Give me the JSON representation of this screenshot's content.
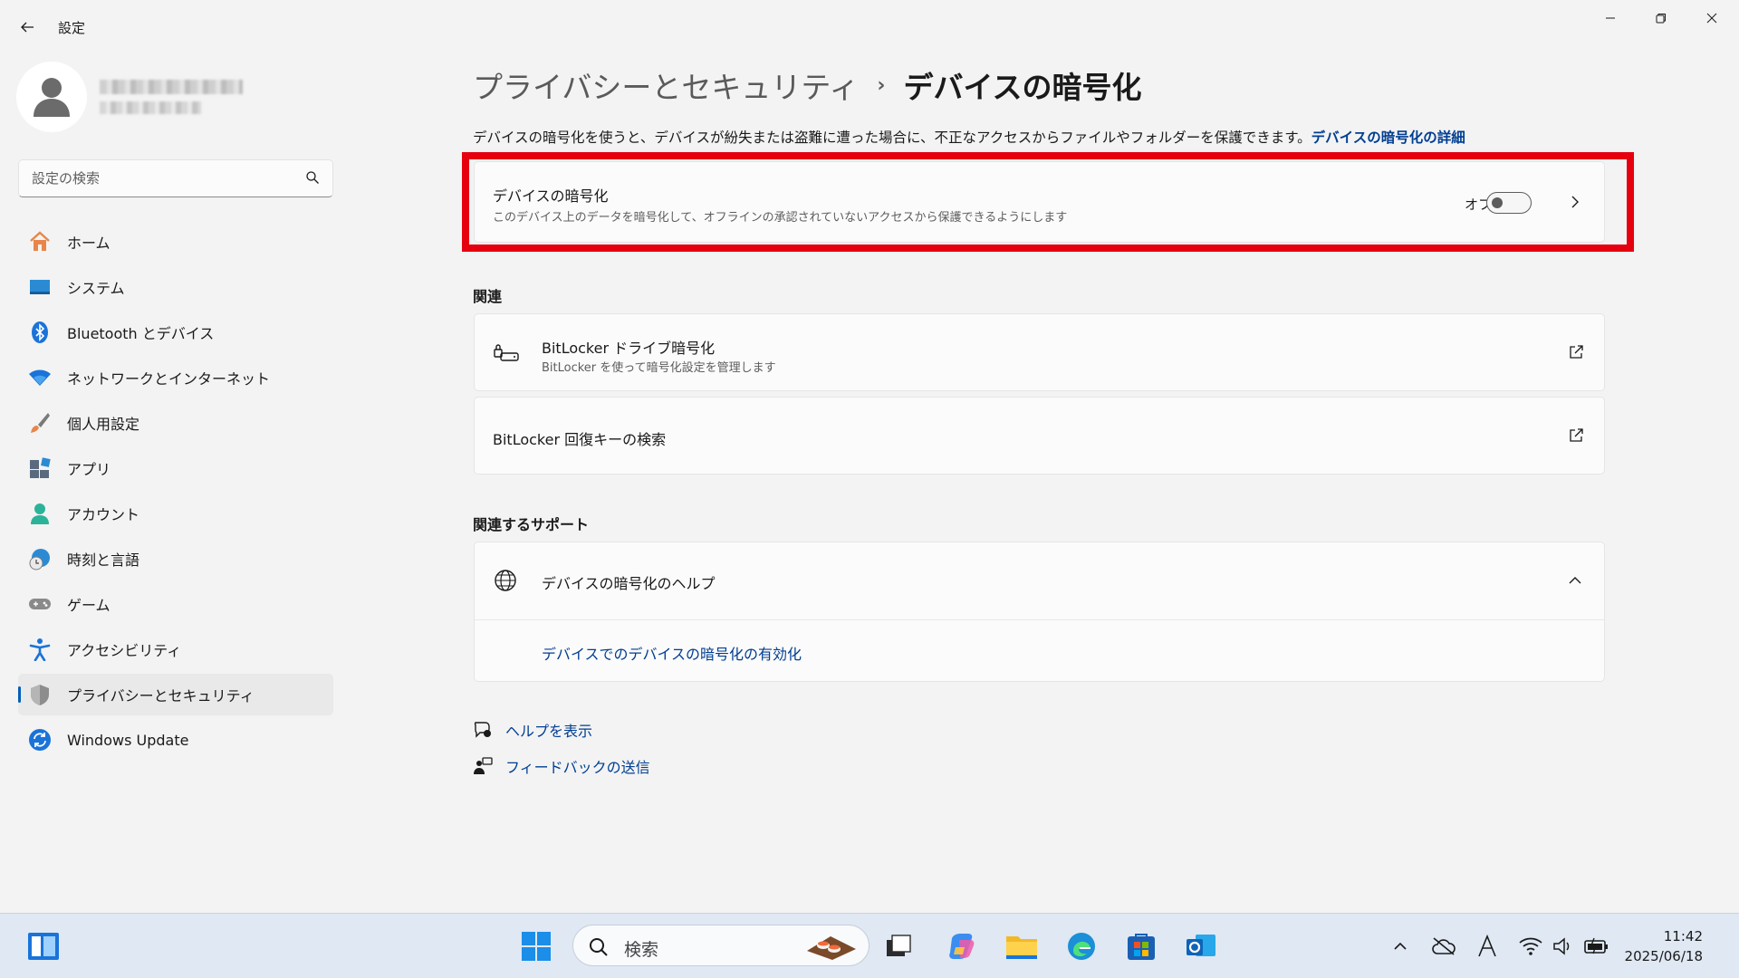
{
  "window": {
    "title": "設定"
  },
  "profile": {
    "name": "",
    "email": ""
  },
  "search": {
    "placeholder": "設定の検索"
  },
  "sidebar": {
    "items": [
      {
        "label": "ホーム",
        "icon": "home-icon"
      },
      {
        "label": "システム",
        "icon": "system-icon"
      },
      {
        "label": "Bluetooth とデバイス",
        "icon": "bluetooth-icon"
      },
      {
        "label": "ネットワークとインターネット",
        "icon": "wifi-icon"
      },
      {
        "label": "個人用設定",
        "icon": "brush-icon"
      },
      {
        "label": "アプリ",
        "icon": "apps-icon"
      },
      {
        "label": "アカウント",
        "icon": "account-icon"
      },
      {
        "label": "時刻と言語",
        "icon": "time-language-icon"
      },
      {
        "label": "ゲーム",
        "icon": "gamepad-icon"
      },
      {
        "label": "アクセシビリティ",
        "icon": "accessibility-icon"
      },
      {
        "label": "プライバシーとセキュリティ",
        "icon": "shield-icon"
      },
      {
        "label": "Windows Update",
        "icon": "update-icon"
      }
    ],
    "active_index": 10
  },
  "main": {
    "breadcrumb_parent": "プライバシーとセキュリティ",
    "breadcrumb_sep": "›",
    "breadcrumb_current": "デバイスの暗号化",
    "description": "デバイスの暗号化を使うと、デバイスが紛失または盗難に遭った場合に、不正なアクセスからファイルやフォルダーを保護できます。",
    "description_link": "デバイスの暗号化の詳細",
    "encryption": {
      "title": "デバイスの暗号化",
      "subtitle": "このデバイス上のデータを暗号化して、オフラインの承認されていないアクセスから保護できるようにします",
      "toggle_label": "オフ",
      "toggle_on": false
    },
    "related": {
      "label": "関連",
      "bitlocker_title": "BitLocker ドライブ暗号化",
      "bitlocker_sub": "BitLocker を使って暗号化設定を管理します",
      "recovery_title": "BitLocker 回復キーの検索"
    },
    "support": {
      "label": "関連するサポート",
      "help_title": "デバイスの暗号化のヘルプ",
      "help_link": "デバイスでのデバイスの暗号化の有効化"
    },
    "footer": {
      "get_help": "ヘルプを表示",
      "feedback": "フィードバックの送信"
    }
  },
  "taskbar": {
    "search_text": "検索",
    "time": "11:42",
    "date": "2025/06/18"
  },
  "colors": {
    "accent": "#005fb8",
    "link": "#003e92",
    "highlight_frame": "#e6000f"
  }
}
